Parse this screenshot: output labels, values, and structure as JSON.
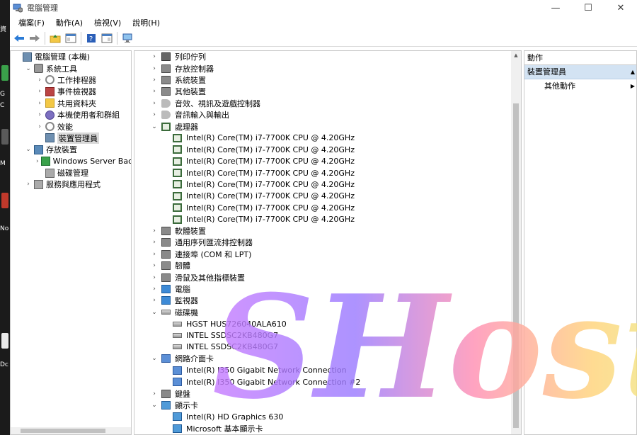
{
  "window": {
    "title": "電腦管理",
    "controls": {
      "minimize": "—",
      "maximize": "☐",
      "close": "✕"
    }
  },
  "menu": [
    "檔案(F)",
    "動作(A)",
    "檢視(V)",
    "說明(H)"
  ],
  "desktop": {
    "labels": [
      "資",
      "G",
      "C",
      "M",
      "No",
      "Dc"
    ]
  },
  "tree": [
    {
      "label": "電腦管理 (本機)",
      "indent": 0,
      "chev": "",
      "icon": "computer-management-icon",
      "cls": "i-dm"
    },
    {
      "label": "系統工具",
      "indent": 1,
      "chev": "v",
      "icon": "tools-icon",
      "cls": "i-tools"
    },
    {
      "label": "工作排程器",
      "indent": 2,
      "chev": ">",
      "icon": "clock-icon",
      "cls": "i-clock"
    },
    {
      "label": "事件檢視器",
      "indent": 2,
      "chev": ">",
      "icon": "event-log-icon",
      "cls": "i-log"
    },
    {
      "label": "共用資料夾",
      "indent": 2,
      "chev": ">",
      "icon": "shared-folder-icon",
      "cls": "i-folder"
    },
    {
      "label": "本機使用者和群組",
      "indent": 2,
      "chev": ">",
      "icon": "users-icon",
      "cls": "i-users"
    },
    {
      "label": "效能",
      "indent": 2,
      "chev": ">",
      "icon": "performance-icon",
      "cls": "i-clock"
    },
    {
      "label": "裝置管理員",
      "indent": 2,
      "chev": "",
      "icon": "device-manager-icon",
      "cls": "i-dm",
      "selected": true
    },
    {
      "label": "存放裝置",
      "indent": 1,
      "chev": "v",
      "icon": "storage-icon",
      "cls": "i-store"
    },
    {
      "label": "Windows Server Backu",
      "indent": 2,
      "chev": ">",
      "icon": "backup-icon",
      "cls": "i-backup"
    },
    {
      "label": "磁碟管理",
      "indent": 2,
      "chev": "",
      "icon": "disk-management-icon",
      "cls": "i-svc"
    },
    {
      "label": "服務與應用程式",
      "indent": 1,
      "chev": ">",
      "icon": "services-icon",
      "cls": "i-svc"
    }
  ],
  "devices": [
    {
      "label": "列印佇列",
      "type": "cat",
      "chev": ">",
      "icon": "printer-icon",
      "cls": "i-printer"
    },
    {
      "label": "存放控制器",
      "type": "cat",
      "chev": ">",
      "icon": "storage-controller-icon",
      "cls": "i-gen"
    },
    {
      "label": "系統裝置",
      "type": "cat",
      "chev": ">",
      "icon": "system-device-icon",
      "cls": "i-gen"
    },
    {
      "label": "其他裝置",
      "type": "cat",
      "chev": ">",
      "icon": "other-device-icon",
      "cls": "i-gen"
    },
    {
      "label": "音效、視訊及遊戲控制器",
      "type": "cat",
      "chev": ">",
      "icon": "sound-icon",
      "cls": "i-snd"
    },
    {
      "label": "音訊輸入與輸出",
      "type": "cat",
      "chev": ">",
      "icon": "audio-io-icon",
      "cls": "i-snd"
    },
    {
      "label": "處理器",
      "type": "cat",
      "chev": "v",
      "icon": "processor-icon",
      "cls": "i-cpu"
    },
    {
      "label": "Intel(R) Core(TM) i7-7700K CPU @ 4.20GHz",
      "type": "child",
      "icon": "processor-icon",
      "cls": "i-cpu"
    },
    {
      "label": "Intel(R) Core(TM) i7-7700K CPU @ 4.20GHz",
      "type": "child",
      "icon": "processor-icon",
      "cls": "i-cpu"
    },
    {
      "label": "Intel(R) Core(TM) i7-7700K CPU @ 4.20GHz",
      "type": "child",
      "icon": "processor-icon",
      "cls": "i-cpu"
    },
    {
      "label": "Intel(R) Core(TM) i7-7700K CPU @ 4.20GHz",
      "type": "child",
      "icon": "processor-icon",
      "cls": "i-cpu"
    },
    {
      "label": "Intel(R) Core(TM) i7-7700K CPU @ 4.20GHz",
      "type": "child",
      "icon": "processor-icon",
      "cls": "i-cpu"
    },
    {
      "label": "Intel(R) Core(TM) i7-7700K CPU @ 4.20GHz",
      "type": "child",
      "icon": "processor-icon",
      "cls": "i-cpu"
    },
    {
      "label": "Intel(R) Core(TM) i7-7700K CPU @ 4.20GHz",
      "type": "child",
      "icon": "processor-icon",
      "cls": "i-cpu"
    },
    {
      "label": "Intel(R) Core(TM) i7-7700K CPU @ 4.20GHz",
      "type": "child",
      "icon": "processor-icon",
      "cls": "i-cpu"
    },
    {
      "label": "軟體裝置",
      "type": "cat",
      "chev": ">",
      "icon": "software-device-icon",
      "cls": "i-gen"
    },
    {
      "label": "通用序列匯流排控制器",
      "type": "cat",
      "chev": ">",
      "icon": "usb-icon",
      "cls": "i-gen"
    },
    {
      "label": "連接埠 (COM 和 LPT)",
      "type": "cat",
      "chev": ">",
      "icon": "port-icon",
      "cls": "i-gen"
    },
    {
      "label": "韌體",
      "type": "cat",
      "chev": ">",
      "icon": "firmware-icon",
      "cls": "i-gen"
    },
    {
      "label": "滑鼠及其他指標裝置",
      "type": "cat",
      "chev": ">",
      "icon": "mouse-icon",
      "cls": "i-gen"
    },
    {
      "label": "電腦",
      "type": "cat",
      "chev": ">",
      "icon": "computer-icon",
      "cls": "i-pc"
    },
    {
      "label": "監視器",
      "type": "cat",
      "chev": ">",
      "icon": "monitor-icon",
      "cls": "i-pc"
    },
    {
      "label": "磁碟機",
      "type": "cat",
      "chev": "v",
      "icon": "disk-drive-icon",
      "cls": "i-disk"
    },
    {
      "label": "HGST HUS726040ALA610",
      "type": "child",
      "icon": "disk-drive-icon",
      "cls": "i-disk"
    },
    {
      "label": "INTEL SSDSC2KB480G7",
      "type": "child",
      "icon": "disk-drive-icon",
      "cls": "i-disk"
    },
    {
      "label": "INTEL SSDSC2KB480G7",
      "type": "child",
      "icon": "disk-drive-icon",
      "cls": "i-disk"
    },
    {
      "label": "網路介面卡",
      "type": "cat",
      "chev": "v",
      "icon": "network-adapter-icon",
      "cls": "i-net"
    },
    {
      "label": "Intel(R) I350 Gigabit Network Connection",
      "type": "child",
      "icon": "network-adapter-icon",
      "cls": "i-net"
    },
    {
      "label": "Intel(R) I350 Gigabit Network Connection #2",
      "type": "child",
      "icon": "network-adapter-icon",
      "cls": "i-net"
    },
    {
      "label": "鍵盤",
      "type": "cat",
      "chev": ">",
      "icon": "keyboard-icon",
      "cls": "i-gen"
    },
    {
      "label": "顯示卡",
      "type": "cat",
      "chev": "v",
      "icon": "display-adapter-icon",
      "cls": "i-disp"
    },
    {
      "label": "Intel(R) HD Graphics 630",
      "type": "child",
      "icon": "display-adapter-icon",
      "cls": "i-disp"
    },
    {
      "label": "Microsoft 基本顯示卡",
      "type": "child",
      "icon": "display-adapter-icon",
      "cls": "i-disp"
    }
  ],
  "actions": {
    "header": "動作",
    "section": "裝置管理員",
    "more": "其他動作"
  },
  "watermark": {
    "text": "SHost"
  }
}
